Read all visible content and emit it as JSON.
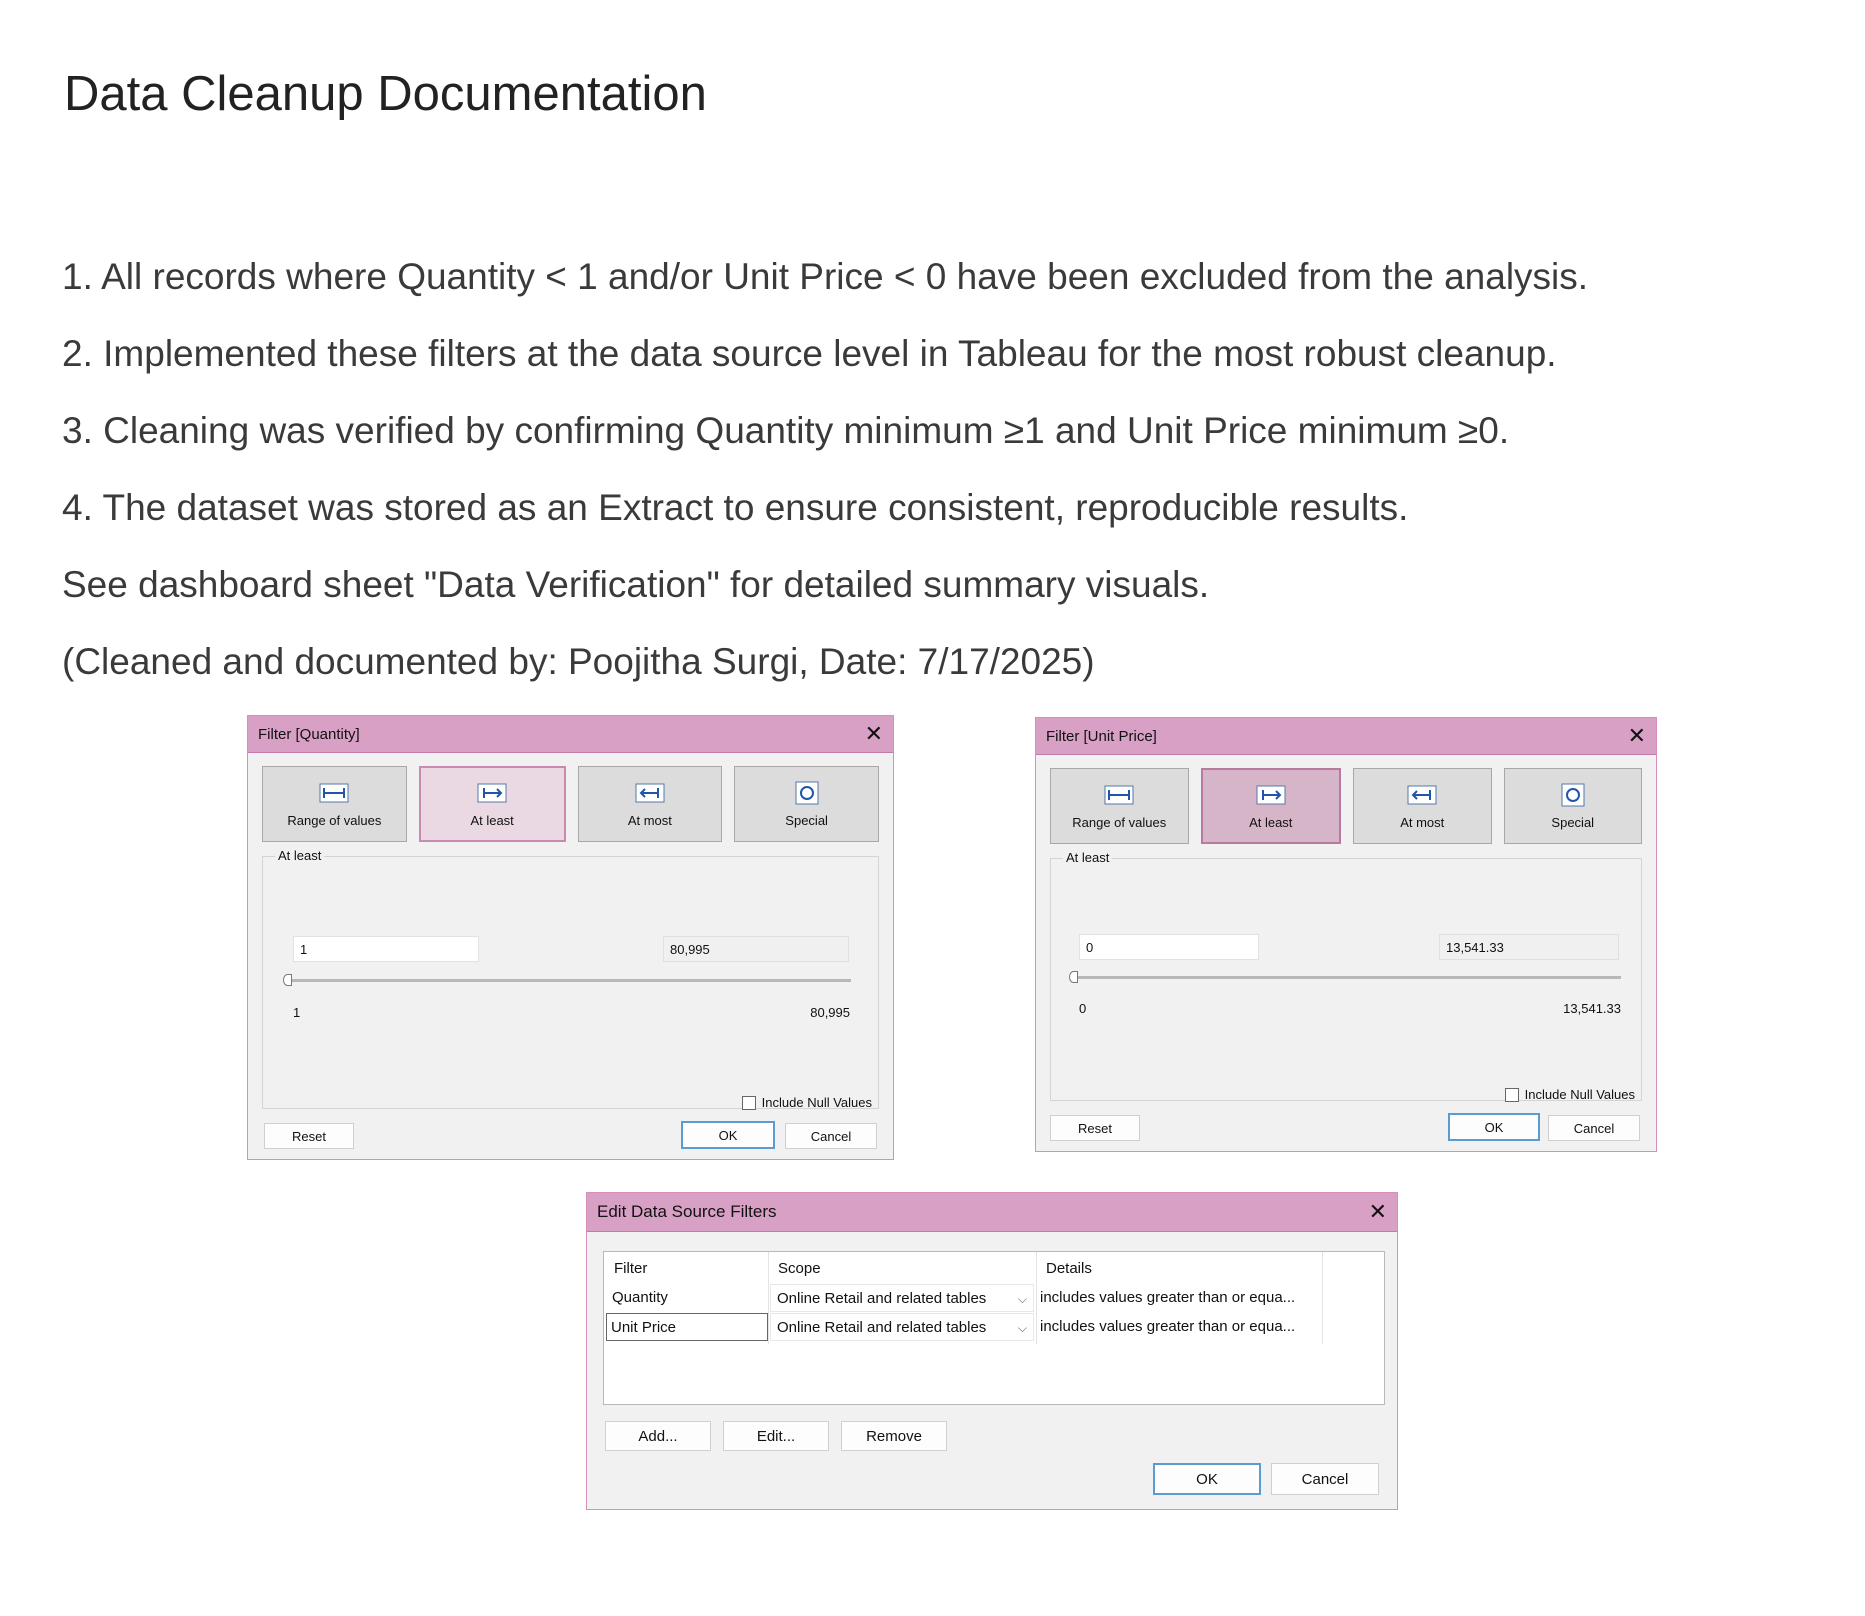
{
  "page": {
    "title": "Data Cleanup Documentation",
    "notes": [
      "1. All records where Quantity < 1 and/or Unit Price < 0 have been excluded from the analysis.",
      "2. Implemented these filters at the data source level in Tableau for the most robust cleanup.",
      "3. Cleaning was verified by confirming Quantity minimum ≥1 and Unit Price minimum ≥0.",
      "4. The dataset was stored as an Extract to ensure consistent, reproducible results.",
      "See dashboard sheet \"Data Verification\" for detailed summary visuals.",
      "(Cleaned and documented by: Poojitha Surgi, Date: 7/17/2025)"
    ]
  },
  "filter_quantity": {
    "title": "Filter [Quantity]",
    "tabs": [
      "Range of values",
      "At least",
      "At most",
      "Special"
    ],
    "active_tab": "At least",
    "group_label": "At least",
    "min_value": "1",
    "max_value": "80,995",
    "range_min_label": "1",
    "range_max_label": "80,995",
    "include_null_label": "Include Null Values",
    "include_null_checked": false,
    "reset_label": "Reset",
    "ok_label": "OK",
    "cancel_label": "Cancel"
  },
  "filter_unit_price": {
    "title": "Filter [Unit Price]",
    "tabs": [
      "Range of values",
      "At least",
      "At most",
      "Special"
    ],
    "active_tab": "At least",
    "group_label": "At least",
    "min_value": "0",
    "max_value": "13,541.33",
    "range_min_label": "0",
    "range_max_label": "13,541.33",
    "include_null_label": "Include Null Values",
    "include_null_checked": false,
    "reset_label": "Reset",
    "ok_label": "OK",
    "cancel_label": "Cancel"
  },
  "edit_data_source_filters": {
    "title": "Edit Data Source Filters",
    "columns": [
      "Filter",
      "Scope",
      "Details"
    ],
    "rows": [
      {
        "filter": "Quantity",
        "scope": "Online Retail and related tables",
        "details": "includes values greater than or equa..."
      },
      {
        "filter": "Unit Price",
        "scope": "Online Retail and related tables",
        "details": "includes values greater than or equa..."
      }
    ],
    "selected_row": "Unit Price",
    "add_label": "Add...",
    "edit_label": "Edit...",
    "remove_label": "Remove",
    "ok_label": "OK",
    "cancel_label": "Cancel"
  },
  "colors": {
    "titlebar": "#d9a0c5",
    "dialog_border": "#d58fb8",
    "active_tab_quantity": "#ead9e3",
    "active_tab_unit_price": "#d7b5c9",
    "ok_border": "#5b9bd5"
  }
}
